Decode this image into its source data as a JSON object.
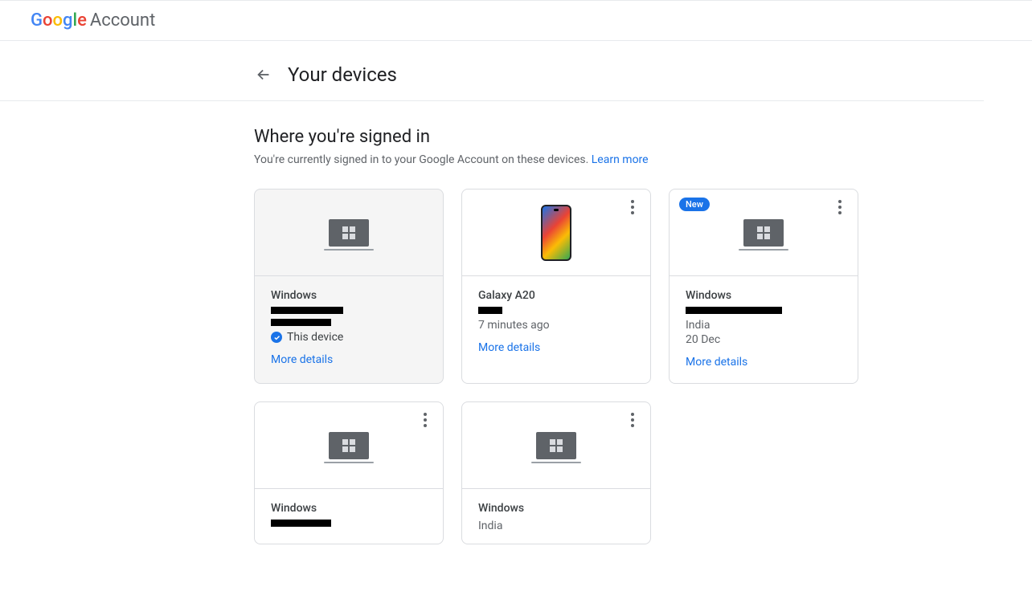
{
  "header": {
    "brand_account": "Account",
    "page_title": "Your devices"
  },
  "section": {
    "title": "Where you're signed in",
    "subtitle_prefix": "You're currently signed in to your Google Account on these devices. ",
    "learn_more": "Learn more"
  },
  "labels": {
    "more_details": "More details",
    "this_device": "This device",
    "new_badge": "New"
  },
  "devices": [
    {
      "name": "Windows",
      "type": "laptop",
      "is_current": true,
      "redactions": [
        "w90",
        "w75"
      ],
      "info_lines": []
    },
    {
      "name": "Galaxy A20",
      "type": "phone",
      "has_menu": true,
      "redactions": [
        "w30"
      ],
      "info_lines": [
        "7 minutes ago"
      ]
    },
    {
      "name": "Windows",
      "type": "laptop",
      "has_menu": true,
      "badge": "new",
      "redactions": [
        "w120"
      ],
      "info_lines": [
        "India",
        "20 Dec"
      ]
    },
    {
      "name": "Windows",
      "type": "laptop",
      "has_menu": true,
      "redactions": [
        "w75"
      ],
      "info_lines": [],
      "truncated": true
    },
    {
      "name": "Windows",
      "type": "laptop",
      "has_menu": true,
      "redactions": [],
      "info_lines": [
        "India"
      ],
      "truncated": true
    }
  ]
}
